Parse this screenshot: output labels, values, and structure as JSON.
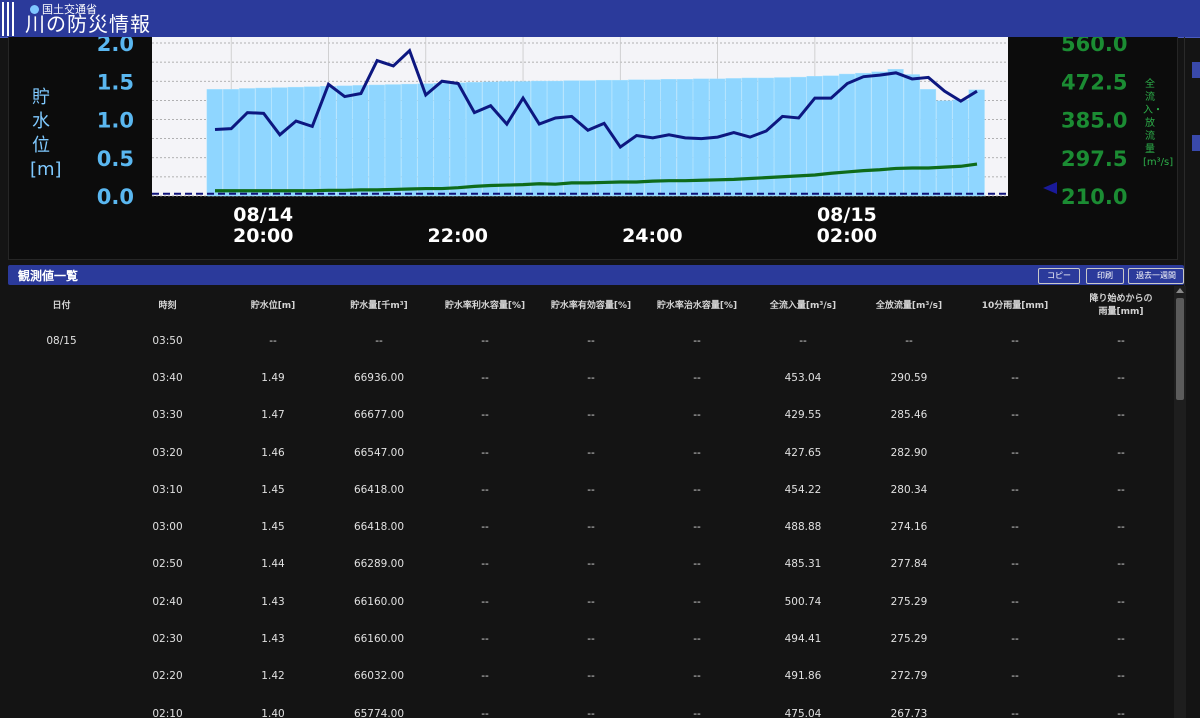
{
  "header": {
    "ministry": "国土交通省",
    "title": "川の防災情報"
  },
  "chart": {
    "left_axis_title": "貯水位[m]",
    "right_axis_title": "全流入・放流量[m³/s]",
    "colors": {
      "water_level": "#0d1780",
      "bars": "#8fd6ff",
      "discharge": "#0e6b1a",
      "left_ticks": "#5ab7f0",
      "right_ticks": "#1b8c33",
      "baseline": "#10137a"
    }
  },
  "chart_data": {
    "type": "line",
    "x": [
      "08/14 19:50",
      "08/14 20:00",
      "08/14 20:10",
      "08/14 20:20",
      "08/14 20:30",
      "08/14 20:40",
      "08/14 20:50",
      "08/14 21:00",
      "08/14 21:10",
      "08/14 21:20",
      "08/14 21:30",
      "08/14 21:40",
      "08/14 21:50",
      "08/14 22:00",
      "08/14 22:10",
      "08/14 22:20",
      "08/14 22:30",
      "08/14 22:40",
      "08/14 22:50",
      "08/14 23:00",
      "08/14 23:10",
      "08/14 23:20",
      "08/14 23:30",
      "08/14 23:40",
      "08/14 23:50",
      "08/15 00:00",
      "08/15 00:10",
      "08/15 00:20",
      "08/15 00:30",
      "08/15 00:40",
      "08/15 00:50",
      "08/15 01:00",
      "08/15 01:10",
      "08/15 01:20",
      "08/15 01:30",
      "08/15 01:40",
      "08/15 01:50",
      "08/15 02:00",
      "08/15 02:10",
      "08/15 02:20",
      "08/15 02:30",
      "08/15 02:40",
      "08/15 02:50",
      "08/15 03:00",
      "08/15 03:10",
      "08/15 03:20",
      "08/15 03:30",
      "08/15 03:40"
    ],
    "x_tick_labels": [
      {
        "date": "08/14",
        "time": "20:00"
      },
      {
        "date": "",
        "time": "22:00"
      },
      {
        "date": "",
        "time": "24:00"
      },
      {
        "date": "08/15",
        "time": "02:00"
      }
    ],
    "left_axis": {
      "ticks": [
        "0.0",
        "0.5",
        "1.0",
        "1.5",
        "2.0"
      ],
      "ylim": [
        0,
        2.0
      ]
    },
    "right_axis": {
      "ticks": [
        "210.0",
        "297.5",
        "385.0",
        "472.5",
        "560.0"
      ],
      "ylim": [
        210,
        560
      ]
    },
    "series": [
      {
        "name": "貯水位",
        "axis": "left",
        "values": [
          0.87,
          0.88,
          1.09,
          1.08,
          0.8,
          0.98,
          0.91,
          1.46,
          1.3,
          1.34,
          1.77,
          1.7,
          1.9,
          1.32,
          1.5,
          1.47,
          1.09,
          1.18,
          0.94,
          1.28,
          0.94,
          1.02,
          1.04,
          0.86,
          0.95,
          0.64,
          0.79,
          0.76,
          0.8,
          0.76,
          0.75,
          0.77,
          0.83,
          0.77,
          0.85,
          1.04,
          1.02,
          1.28,
          1.28,
          1.47,
          1.56,
          1.58,
          1.61,
          1.53,
          1.55,
          1.37,
          1.24,
          1.37
        ]
      },
      {
        "name": "全流入量",
        "axis": "right",
        "values": [
          454,
          454,
          456,
          457,
          458,
          459,
          460,
          461,
          462,
          463,
          464,
          465,
          466,
          467,
          468,
          469,
          470,
          471,
          472,
          472,
          473,
          473,
          474,
          474,
          475,
          475,
          476,
          476,
          477,
          477,
          478,
          478,
          479,
          480,
          480,
          481,
          482,
          484,
          485,
          489,
          491,
          494,
          500,
          488,
          454,
          428,
          430,
          453
        ]
      },
      {
        "name": "全放流量",
        "axis": "right",
        "values": [
          222,
          222,
          222,
          222,
          222,
          222,
          222,
          223,
          223,
          224,
          224,
          225,
          226,
          227,
          227,
          229,
          232,
          234,
          235,
          236,
          238,
          237,
          240,
          240,
          241,
          242,
          242,
          244,
          245,
          245,
          246,
          247,
          248,
          250,
          252,
          254,
          256,
          258,
          262,
          265,
          268,
          270,
          273,
          274,
          274,
          276,
          278,
          283
        ]
      }
    ],
    "baseline_value": 0.03
  },
  "table": {
    "title": "観測値一覧",
    "buttons": {
      "copy": "コピー",
      "print": "印刷",
      "week": "過去一週間"
    },
    "columns": [
      "日付",
      "時刻",
      "貯水位[m]",
      "貯水量[千m³]",
      "貯水率利水容量[%]",
      "貯水率有効容量[%]",
      "貯水率治水容量[%]",
      "全流入量[m³/s]",
      "全放流量[m³/s]",
      "10分雨量[mm]",
      "降り始めからの雨量[mm]"
    ],
    "rows": [
      [
        "08/15",
        "03:50",
        "--",
        "--",
        "--",
        "--",
        "--",
        "--",
        "--",
        "--",
        "--"
      ],
      [
        "",
        "03:40",
        "1.49",
        "66936.00",
        "--",
        "--",
        "--",
        "453.04",
        "290.59",
        "--",
        "--"
      ],
      [
        "",
        "03:30",
        "1.47",
        "66677.00",
        "--",
        "--",
        "--",
        "429.55",
        "285.46",
        "--",
        "--"
      ],
      [
        "",
        "03:20",
        "1.46",
        "66547.00",
        "--",
        "--",
        "--",
        "427.65",
        "282.90",
        "--",
        "--"
      ],
      [
        "",
        "03:10",
        "1.45",
        "66418.00",
        "--",
        "--",
        "--",
        "454.22",
        "280.34",
        "--",
        "--"
      ],
      [
        "",
        "03:00",
        "1.45",
        "66418.00",
        "--",
        "--",
        "--",
        "488.88",
        "274.16",
        "--",
        "--"
      ],
      [
        "",
        "02:50",
        "1.44",
        "66289.00",
        "--",
        "--",
        "--",
        "485.31",
        "277.84",
        "--",
        "--"
      ],
      [
        "",
        "02:40",
        "1.43",
        "66160.00",
        "--",
        "--",
        "--",
        "500.74",
        "275.29",
        "--",
        "--"
      ],
      [
        "",
        "02:30",
        "1.43",
        "66160.00",
        "--",
        "--",
        "--",
        "494.41",
        "275.29",
        "--",
        "--"
      ],
      [
        "",
        "02:20",
        "1.42",
        "66032.00",
        "--",
        "--",
        "--",
        "491.86",
        "272.79",
        "--",
        "--"
      ],
      [
        "",
        "02:10",
        "1.40",
        "65774.00",
        "--",
        "--",
        "--",
        "475.04",
        "267.73",
        "--",
        "--"
      ]
    ]
  }
}
